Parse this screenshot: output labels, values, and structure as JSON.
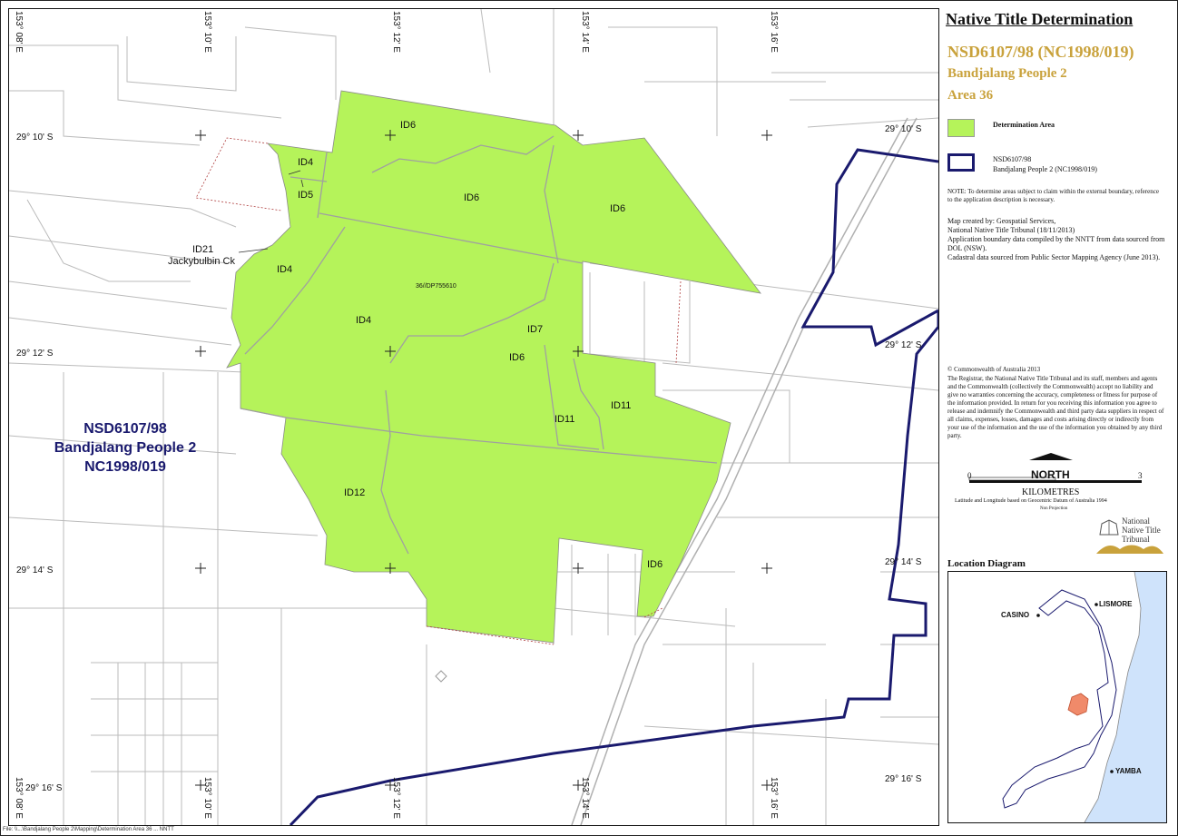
{
  "legend": {
    "title": "Native Title Determination",
    "claim_id": "NSD6107/98 (NC1998/019)",
    "claim_name": "Bandjalang People 2",
    "area": "Area 36",
    "determination_area_label": "Determination Area",
    "boundary_label_line1": "NSD6107/98",
    "boundary_label_line2": "Bandjalang People 2 (NC1998/019)",
    "note": "NOTE: To determine areas subject to claim within the external boundary, reference to the application description is necessary.",
    "map_created_by": "Map created by: Geospatial Services,",
    "created_org": "National Native Title Tribunal   (18/11/2013)",
    "source_1": "Application boundary data compiled by the NNTT from data sourced from DOL (NSW).",
    "source_2": "Cadastral data sourced from Public Sector Mapping Agency (June 2013).",
    "copyright": "© Commonwealth of Australia 2013",
    "disclaimer": "The Registrar, the National Native Title Tribunal and its staff, members and agents and the Commonwealth (collectively the Commonwealth) accept no liability and give no warranties concerning the accuracy, completeness or fitness for purpose of the information provided. In return for you receiving this information you agree to release and indemnify the Commonwealth and third party data suppliers in respect of all claims, expenses, losses, damages and costs arising directly or indirectly from your use of the information and the use of the information you obtained by any third party.",
    "north": "NORTH",
    "scale_start": "0",
    "scale_end": "3",
    "scale_unit": "KILOMETRES",
    "datum": "Latitude and Longitude based on Geocentric Datum of Australia 1994",
    "projection": "Non Projection",
    "nntt_logo_text": [
      "National",
      "Native Title",
      "Tribunal"
    ],
    "location_title": "Location Diagram",
    "towns": [
      "CASINO",
      "LISMORE",
      "YAMBA"
    ]
  },
  "map": {
    "claim_label": [
      "NSD6107/98",
      "Bandjalang People 2",
      "NC1998/019"
    ],
    "parcel_labels": [
      "ID6",
      "ID6",
      "ID6",
      "ID4",
      "ID5",
      "ID21",
      "Jackybulbin Ck",
      "ID4",
      "36//DP755610",
      "ID4",
      "ID7",
      "ID6",
      "ID11",
      "ID11",
      "ID12",
      "ID6"
    ],
    "lat_labels": [
      "29° 10' S",
      "29° 10' S",
      "29° 12' S",
      "29° 12' S",
      "29° 14' S",
      "29° 14' S",
      "29° 16' S",
      "29° 16' S"
    ],
    "lon_labels_top": [
      "153° 08' E",
      "153° 10' E",
      "153° 12' E",
      "153° 14' E",
      "153° 16' E"
    ],
    "lon_labels_bottom": [
      "153° 08' E",
      "153° 10' E",
      "153° 12' E",
      "153° 14' E",
      "153° 16' E"
    ]
  },
  "colors": {
    "determination_fill": "#b5f35a",
    "boundary": "#1a1a6e",
    "title_gold": "#c9a23c",
    "location_highlight": "#f08a6a",
    "sea": "#cfe3fb"
  },
  "footer": "File: \\\\...\\Bandjalang People 2\\Mapping\\Determination Area 36 ... NNTT"
}
